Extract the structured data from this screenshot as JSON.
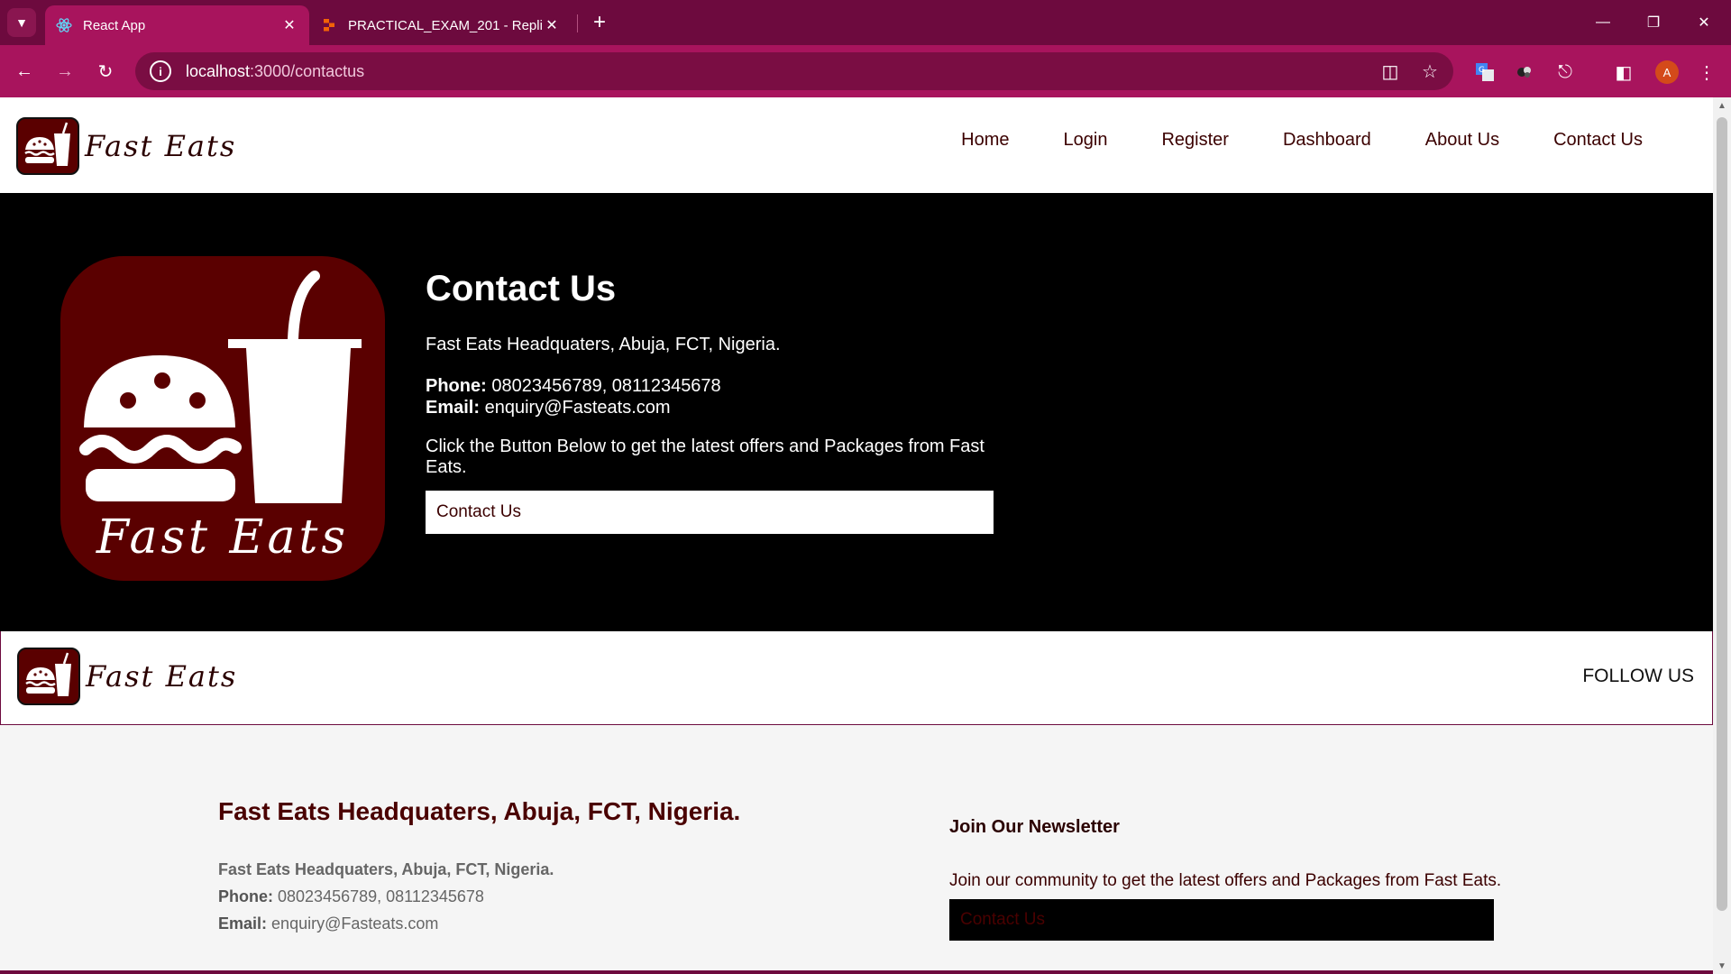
{
  "browser": {
    "tabs": [
      {
        "title": "React App",
        "favicon": "react-icon",
        "active": true
      },
      {
        "title": "PRACTICAL_EXAM_201 - Replit",
        "favicon": "replit-icon",
        "active": false
      }
    ],
    "url_host": "localhost",
    "url_path": ":3000/contactus",
    "profile_initial": "A",
    "colors": {
      "frame": "#6d0a3e",
      "toolbar": "#a8145d",
      "omnibox": "#7a0d43"
    }
  },
  "site": {
    "brand_name": "Fast Eats",
    "nav": [
      "Home",
      "Login",
      "Register",
      "Dashboard",
      "About Us",
      "Contact Us"
    ],
    "colors": {
      "brand": "#5a0000",
      "hero_bg": "#000000",
      "text_dark": "#3b0000"
    }
  },
  "hero": {
    "logo_text": "Fast Eats",
    "title": "Contact Us",
    "address": "Fast Eats Headquaters, Abuja, FCT, Nigeria.",
    "phone_label": "Phone:",
    "phone": "08023456789, 08112345678",
    "email_label": "Email:",
    "email": "enquiry@Fasteats.com",
    "cta_text": "Click the Button Below to get the latest offers and Packages from Fast Eats.",
    "button_label": "Contact Us"
  },
  "footer": {
    "brand_name": "Fast Eats",
    "follow_us": "FOLLOW US",
    "title": "Fast Eats Headquaters, Abuja, FCT, Nigeria.",
    "address": "Fast Eats Headquaters, Abuja, FCT, Nigeria.",
    "phone_label": "Phone:",
    "phone": "08023456789, 08112345678",
    "email_label": "Email:",
    "email": "enquiry@Fasteats.com",
    "newsletter_title": "Join Our Newsletter",
    "newsletter_desc": "Join our community to get the latest offers and Packages from Fast Eats.",
    "newsletter_button": "Contact Us"
  }
}
